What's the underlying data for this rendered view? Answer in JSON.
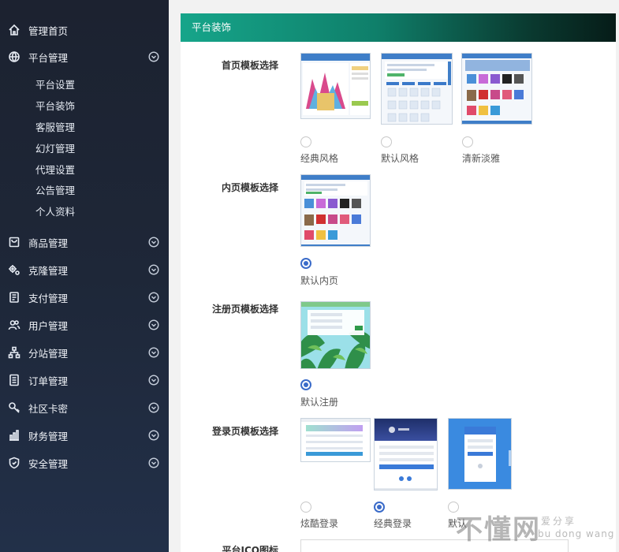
{
  "sidebar": {
    "items": [
      {
        "label": "管理首页",
        "icon": "home-icon",
        "has_chevron": false
      },
      {
        "label": "平台管理",
        "icon": "globe-icon",
        "has_chevron": true
      },
      {
        "label": "商品管理",
        "icon": "bag-icon",
        "has_chevron": true
      },
      {
        "label": "克隆管理",
        "icon": "gears-icon",
        "has_chevron": true
      },
      {
        "label": "支付管理",
        "icon": "receipt-icon",
        "has_chevron": true
      },
      {
        "label": "用户管理",
        "icon": "users-icon",
        "has_chevron": true
      },
      {
        "label": "分站管理",
        "icon": "sitemap-icon",
        "has_chevron": true
      },
      {
        "label": "订单管理",
        "icon": "document-icon",
        "has_chevron": true
      },
      {
        "label": "社区卡密",
        "icon": "key-icon",
        "has_chevron": true
      },
      {
        "label": "财务管理",
        "icon": "bar-chart-icon",
        "has_chevron": true
      },
      {
        "label": "安全管理",
        "icon": "shield-icon",
        "has_chevron": true
      }
    ],
    "platform_sub": [
      "平台设置",
      "平台装饰",
      "客服管理",
      "幻灯管理",
      "代理设置",
      "公告管理",
      "个人资料"
    ]
  },
  "panel": {
    "title": "平台装饰",
    "home_template": {
      "label": "首页模板选择",
      "options": [
        {
          "label": "经典风格",
          "checked": false
        },
        {
          "label": "默认风格",
          "checked": false
        },
        {
          "label": "清新淡雅",
          "checked": false
        }
      ]
    },
    "inner_template": {
      "label": "内页模板选择",
      "options": [
        {
          "label": "默认内页",
          "checked": true
        }
      ]
    },
    "register_template": {
      "label": "注册页模板选择",
      "options": [
        {
          "label": "默认注册",
          "checked": true
        }
      ]
    },
    "login_template": {
      "label": "登录页模板选择",
      "options": [
        {
          "label": "炫酷登录",
          "checked": false
        },
        {
          "label": "经典登录",
          "checked": true
        },
        {
          "label": "默认",
          "checked": false
        }
      ]
    },
    "ico_label": "平台ICO图标"
  },
  "watermark": {
    "main": "不懂网",
    "cn": "爱分享",
    "en": "bu dong wang"
  },
  "colors": {
    "accent": "#3a6bc9",
    "header_green": "#16a58a",
    "sidebar_bg": "#1e2738"
  }
}
